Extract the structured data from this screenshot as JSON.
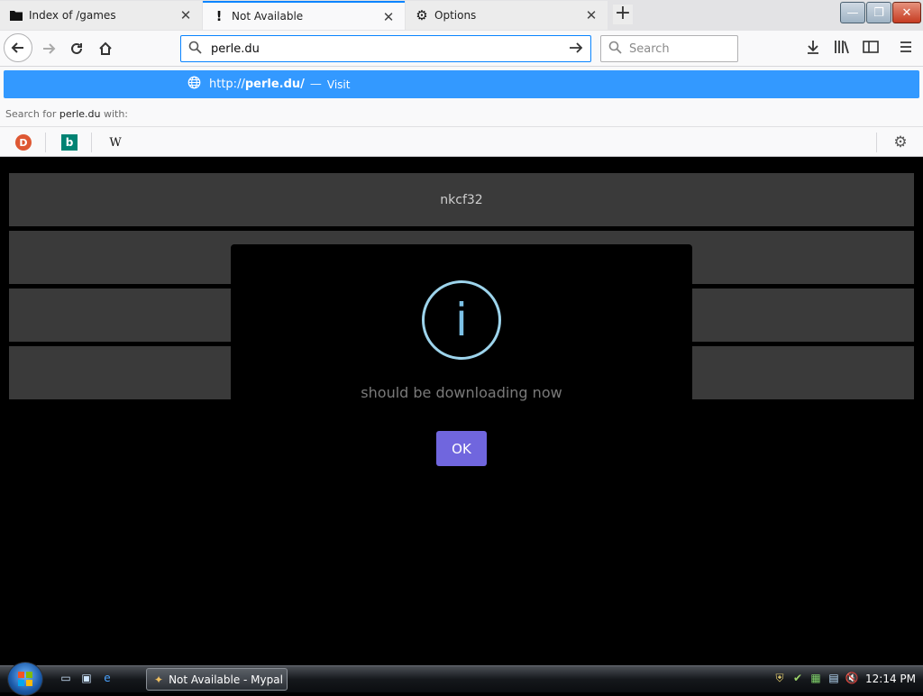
{
  "browser": {
    "tabs": [
      {
        "title": "Index of /games",
        "icon": "folder-icon",
        "active": false
      },
      {
        "title": "Not Available",
        "icon": "exclamation-icon",
        "active": true
      },
      {
        "title": "Options",
        "icon": "gear-icon",
        "active": false
      }
    ],
    "new_tab_label": "+",
    "window_buttons": {
      "minimize": "—",
      "restore": "❐",
      "close": "✕"
    },
    "url": "perle.du",
    "search_placeholder": "Search"
  },
  "dropdown": {
    "suggestion_url_prefix": "http://",
    "suggestion_url_host": "perle.du/",
    "suggestion_separator": "—",
    "suggestion_action": "Visit",
    "search_for_prefix": "Search for ",
    "search_for_term": "perle.du",
    "search_for_suffix": " with:",
    "engines": [
      "duckduckgo-icon",
      "bing-icon",
      "wikipedia-icon"
    ],
    "engine_glyphs": {
      "duckduckgo": "D",
      "bing": "b",
      "wikipedia": "W"
    }
  },
  "page": {
    "rows": [
      "nkcf32",
      "",
      "",
      ""
    ],
    "modal": {
      "icon_glyph": "i",
      "message": "should be downloading now",
      "ok_label": "OK",
      "ok_color": "#7066de",
      "icon_color": "#9dd4ec"
    }
  },
  "taskbar": {
    "task_title": "Not Available - Mypal",
    "clock": "12:14 PM"
  },
  "colors": {
    "accent": "#0a84ff",
    "suggestion_bg": "#3399ff"
  }
}
